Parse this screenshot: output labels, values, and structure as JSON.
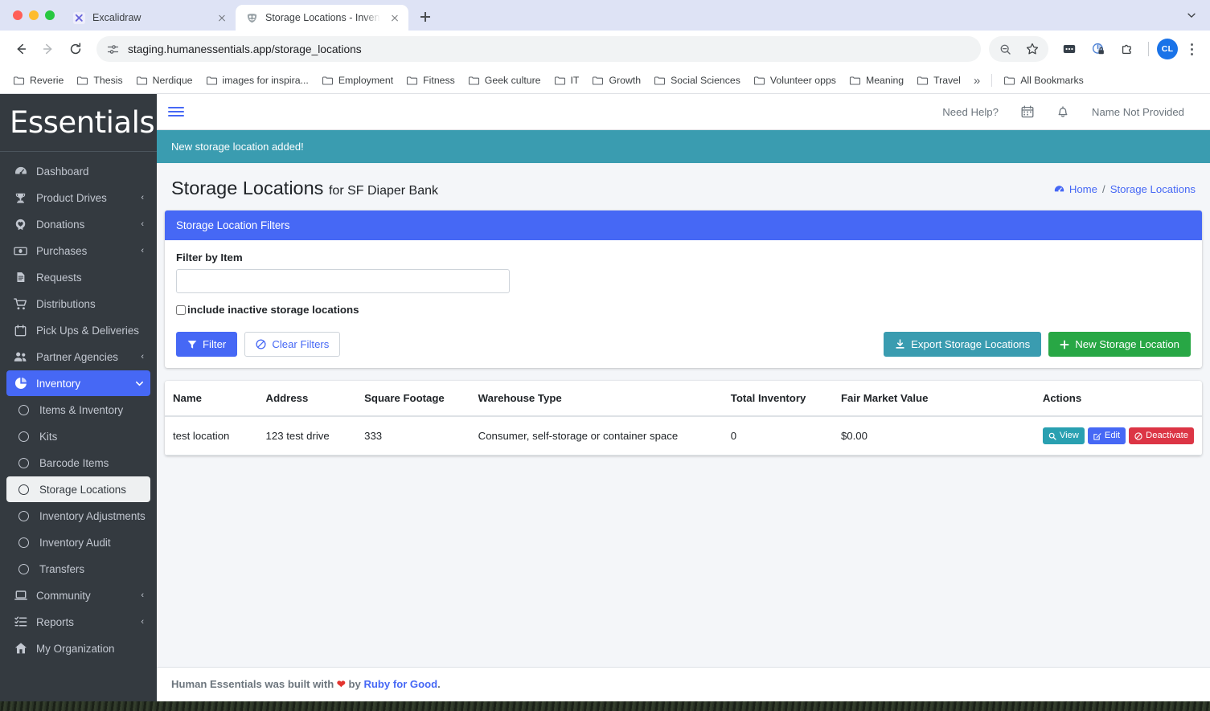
{
  "browser": {
    "tabs": [
      {
        "title": "Excalidraw",
        "favicon": "excalidraw-icon",
        "active": false
      },
      {
        "title": "Storage Locations - Inventory",
        "favicon": "human-essentials-icon",
        "active": true
      }
    ],
    "new_tab_label": "+",
    "omnibox": {
      "url": "staging.humanessentials.app/storage_locations",
      "site_info_icon": "tune-icon",
      "zoom_icon": "zoom-out-icon",
      "bookmark_icon": "star-icon"
    },
    "nav": {
      "back": "back-icon",
      "forward": "forward-icon",
      "reload": "reload-icon"
    },
    "toolbar_icons": [
      "extension-dots-icon",
      "privacy-lock-icon",
      "extensions-puzzle-icon"
    ],
    "profile_initials": "CL",
    "bookmarks": [
      "Reverie",
      "Thesis",
      "Nerdique",
      "images for inspira...",
      "Employment",
      "Fitness",
      "Geek culture",
      "IT",
      "Growth",
      "Social Sciences",
      "Volunteer opps",
      "Meaning",
      "Travel"
    ],
    "bookmarks_overflow": "»",
    "all_bookmarks": "All Bookmarks"
  },
  "app": {
    "brand": "Essentials",
    "header": {
      "need_help": "Need Help?",
      "calendar_icon": "calendar-icon",
      "bell_icon": "bell-icon",
      "user_name": "Name Not Provided"
    },
    "alert": "New storage location added!",
    "page_title": "Storage Locations",
    "page_subtitle": "for SF Diaper Bank",
    "breadcrumb": {
      "home": "Home",
      "separator": "/",
      "current": "Storage Locations"
    },
    "sidebar": [
      {
        "label": "Dashboard",
        "icon": "dashboard-icon",
        "caret": "",
        "state": ""
      },
      {
        "label": "Product Drives",
        "icon": "trophy-icon",
        "caret": "‹",
        "state": ""
      },
      {
        "label": "Donations",
        "icon": "heart-badge-icon",
        "caret": "‹",
        "state": ""
      },
      {
        "label": "Purchases",
        "icon": "money-icon",
        "caret": "‹",
        "state": ""
      },
      {
        "label": "Requests",
        "icon": "document-icon",
        "caret": "",
        "state": ""
      },
      {
        "label": "Distributions",
        "icon": "cart-icon",
        "caret": "",
        "state": ""
      },
      {
        "label": "Pick Ups & Deliveries",
        "icon": "calendar-icon",
        "caret": "",
        "state": ""
      },
      {
        "label": "Partner Agencies",
        "icon": "people-icon",
        "caret": "‹",
        "state": ""
      },
      {
        "label": "Inventory",
        "icon": "pie-chart-icon",
        "caret": "⌄",
        "state": "active"
      },
      {
        "label": "Items & Inventory",
        "icon": "circle-icon",
        "caret": "",
        "state": "sub"
      },
      {
        "label": "Kits",
        "icon": "circle-icon",
        "caret": "",
        "state": "sub"
      },
      {
        "label": "Barcode Items",
        "icon": "circle-icon",
        "caret": "",
        "state": "sub"
      },
      {
        "label": "Storage Locations",
        "icon": "circle-icon",
        "caret": "",
        "state": "sub selected"
      },
      {
        "label": "Inventory Adjustments",
        "icon": "circle-icon",
        "caret": "",
        "state": "sub"
      },
      {
        "label": "Inventory Audit",
        "icon": "circle-icon",
        "caret": "",
        "state": "sub"
      },
      {
        "label": "Transfers",
        "icon": "circle-icon",
        "caret": "",
        "state": "sub"
      },
      {
        "label": "Community",
        "icon": "laptop-icon",
        "caret": "‹",
        "state": ""
      },
      {
        "label": "Reports",
        "icon": "list-check-icon",
        "caret": "‹",
        "state": ""
      },
      {
        "label": "My Organization",
        "icon": "home-icon",
        "caret": "",
        "state": ""
      }
    ],
    "filters": {
      "card_title": "Storage Location Filters",
      "filter_by_item_label": "Filter by Item",
      "filter_by_item_value": "",
      "filter_by_item_placeholder": "",
      "include_inactive_label": "include inactive storage locations",
      "include_inactive_checked": false,
      "filter_button": "Filter",
      "clear_filters_button": "Clear Filters",
      "export_button": "Export Storage Locations",
      "new_button": "New Storage Location"
    },
    "table": {
      "columns": [
        "Name",
        "Address",
        "Square Footage",
        "Warehouse Type",
        "Total Inventory",
        "Fair Market Value",
        "Actions"
      ],
      "rows": [
        {
          "name": "test location",
          "address": "123 test drive",
          "square_footage": "333",
          "warehouse_type": "Consumer, self-storage or container space",
          "total_inventory": "0",
          "fair_market_value": "$0.00",
          "actions": [
            {
              "label": "View",
              "icon": "magnifier-icon",
              "style": "bg-view"
            },
            {
              "label": "Edit",
              "icon": "pencil-square-icon",
              "style": "bg-edit"
            },
            {
              "label": "Deactivate",
              "icon": "ban-icon",
              "style": "bg-deact"
            }
          ]
        }
      ]
    },
    "footer": {
      "prefix": "Human Essentials was built with",
      "heart": "❤",
      "middle": "by",
      "link": "Ruby for Good",
      "suffix": "."
    }
  },
  "colors": {
    "accent_blue": "#4668f5",
    "teal": "#3a9cb0",
    "green": "#28a745",
    "red": "#dc3545",
    "sidebar_dark": "#343a40",
    "page_bg": "#f4f6f9"
  }
}
